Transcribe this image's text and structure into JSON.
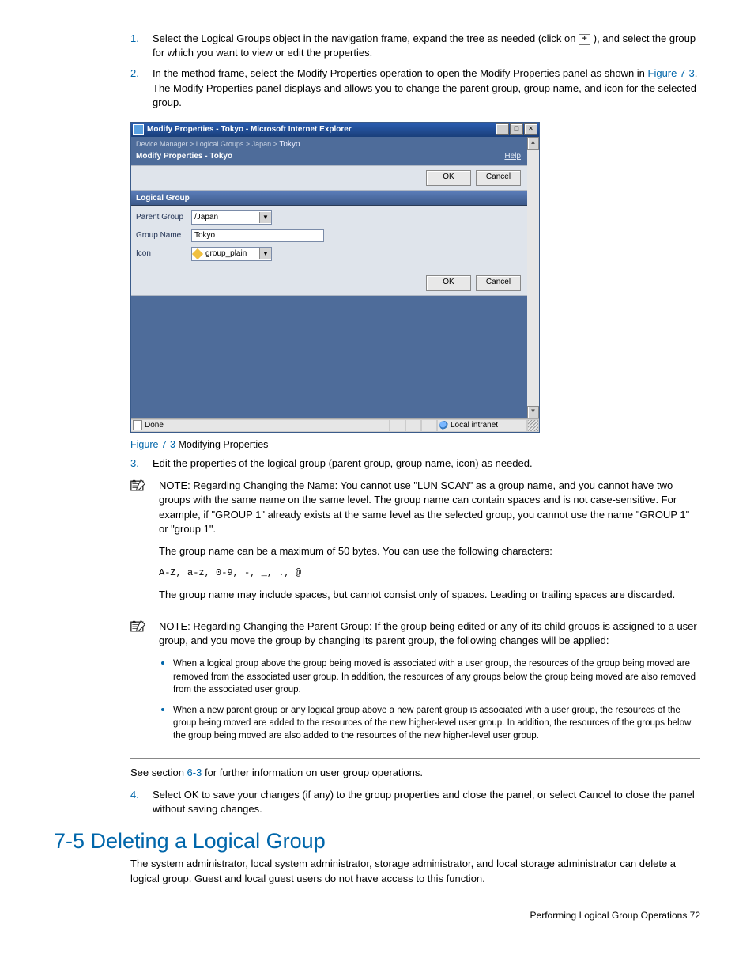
{
  "steps": {
    "s1_num": "1.",
    "s1_a": "Select the Logical Groups object in the navigation frame, expand the tree as needed (click on ",
    "s1_b": "), and select the group for which you want to view or edit the properties.",
    "s2_num": "2.",
    "s2_a": "In the method frame, select the Modify Properties operation to open the Modify Properties panel as shown in ",
    "s2_link": "Figure 7-3",
    "s2_b": ". The Modify Properties panel displays and allows you to change the parent group, group name, and icon for the selected group.",
    "s3_num": "3.",
    "s3": "Edit the properties of the logical group (parent group, group name, icon) as needed.",
    "s4_num": "4.",
    "s4": "Select OK to save your changes (if any) to the group properties and close the panel, or select Cancel to close the panel without saving changes."
  },
  "screenshot": {
    "title": "Modify Properties - Tokyo - Microsoft Internet Explorer",
    "breadcrumb": {
      "a": "Device Manager",
      "b": "Logical Groups",
      "c": "Japan",
      "d": "Tokyo"
    },
    "panel_title": "Modify Properties - Tokyo",
    "help": "Help",
    "ok": "OK",
    "cancel": "Cancel",
    "section": "Logical Group",
    "labels": {
      "parent": "Parent Group",
      "name": "Group Name",
      "icon": "Icon"
    },
    "values": {
      "parent": "/Japan",
      "name": "Tokyo",
      "icon": "group_plain"
    },
    "status_done": "Done",
    "status_zone": "Local intranet"
  },
  "caption": {
    "num": "Figure 7-3",
    "text": " Modifying Properties"
  },
  "note1": {
    "prefix": "NOTE:",
    "p1": " Regarding Changing the Name: You cannot use \"LUN SCAN\" as a group name, and you cannot have two groups with the same name on the same level. The group name can contain spaces and is not case-sensitive. For example, if \"GROUP 1\" already exists at the same level as the selected group, you cannot use the name \"GROUP 1\" or \"group 1\".",
    "p2": "The group name can be a maximum of 50 bytes. You can use the following characters:",
    "chars": "A-Z, a-z, 0-9, -, _, ., @",
    "p3": "The group name may include spaces, but cannot consist only of spaces. Leading or trailing spaces are discarded."
  },
  "note2": {
    "prefix": "NOTE:",
    "p1": " Regarding Changing the Parent Group: If the group being edited or any of its child groups is assigned to a user group, and you move the group by changing its parent group, the following changes will be applied:",
    "b1": "When a logical group above the group being moved is associated with a user group, the resources of the group being moved are removed from the associated user group. In addition, the resources of any groups below the group being moved are also removed from the associated user group.",
    "b2": "When a new parent group or any logical group above a new parent group is associated with a user group, the resources of the group being moved are added to the resources of the new higher-level user group. In addition, the resources of the groups below the group being moved are also added to the resources of the new higher-level user group."
  },
  "see": {
    "a": "See section ",
    "link": "6-3",
    "b": " for further information on user group operations."
  },
  "heading": "7-5 Deleting a Logical Group",
  "intro": "The system administrator, local system administrator, storage administrator, and local storage administrator can delete a logical group. Guest and local guest users do not have access to this function.",
  "footer": "Performing Logical Group Operations   72"
}
